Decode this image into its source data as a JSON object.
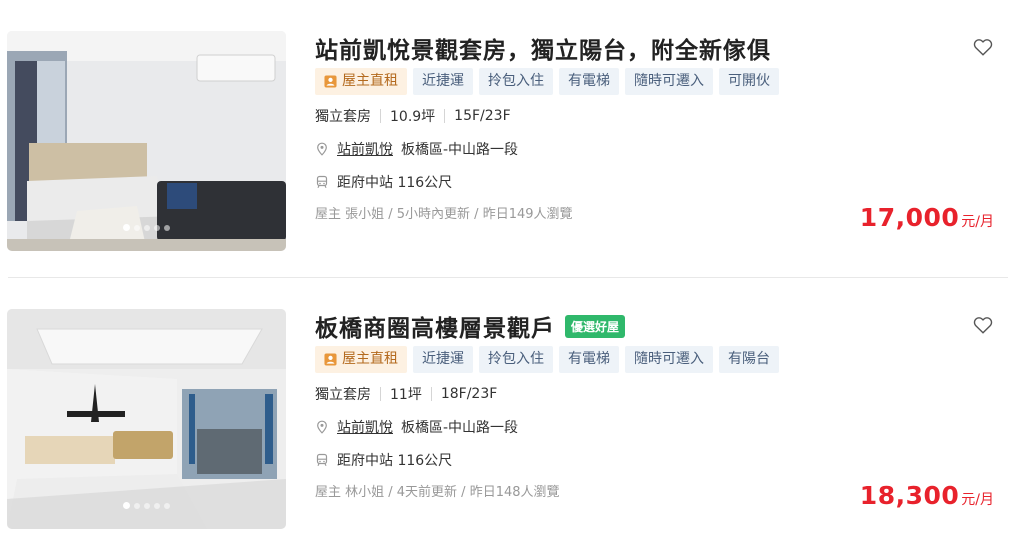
{
  "listings": [
    {
      "title": "站前凱悅景觀套房，獨立陽台，附全新傢俱",
      "pick_badge": "",
      "tags": [
        "屋主直租",
        "近捷運",
        "拎包入住",
        "有電梯",
        "隨時可遷入",
        "可開伙"
      ],
      "type": "獨立套房",
      "size": "10.9坪",
      "floor": "15F/23F",
      "community": "站前凱悅",
      "address": "板橋區-中山路一段",
      "transit": "距府中站 116公尺",
      "agent": "屋主 張小姐 / 5小時內更新 / 昨日149人瀏覽",
      "price": "17,000",
      "price_unit": "元/月",
      "photo_total": 5,
      "photo_index": 1
    },
    {
      "title": "板橋商圈高樓層景觀戶",
      "pick_badge": "優選好屋",
      "tags": [
        "屋主直租",
        "近捷運",
        "拎包入住",
        "有電梯",
        "隨時可遷入",
        "有陽台"
      ],
      "type": "獨立套房",
      "size": "11坪",
      "floor": "18F/23F",
      "community": "站前凱悅",
      "address": "板橋區-中山路一段",
      "transit": "距府中站 116公尺",
      "agent": "屋主 林小姐 / 4天前更新 / 昨日148人瀏覽",
      "price": "18,300",
      "price_unit": "元/月",
      "photo_total": 5,
      "photo_index": 1
    }
  ],
  "icons": {
    "favorite": "heart-outline-icon",
    "location": "location-pin-icon",
    "transit": "train-icon",
    "owner": "person-badge-icon"
  },
  "colors": {
    "price": "#e8222c",
    "pick_badge": "#2fb86b",
    "tag_bg": "#eef3f8",
    "owner_tag_bg": "#fdf1e2"
  }
}
